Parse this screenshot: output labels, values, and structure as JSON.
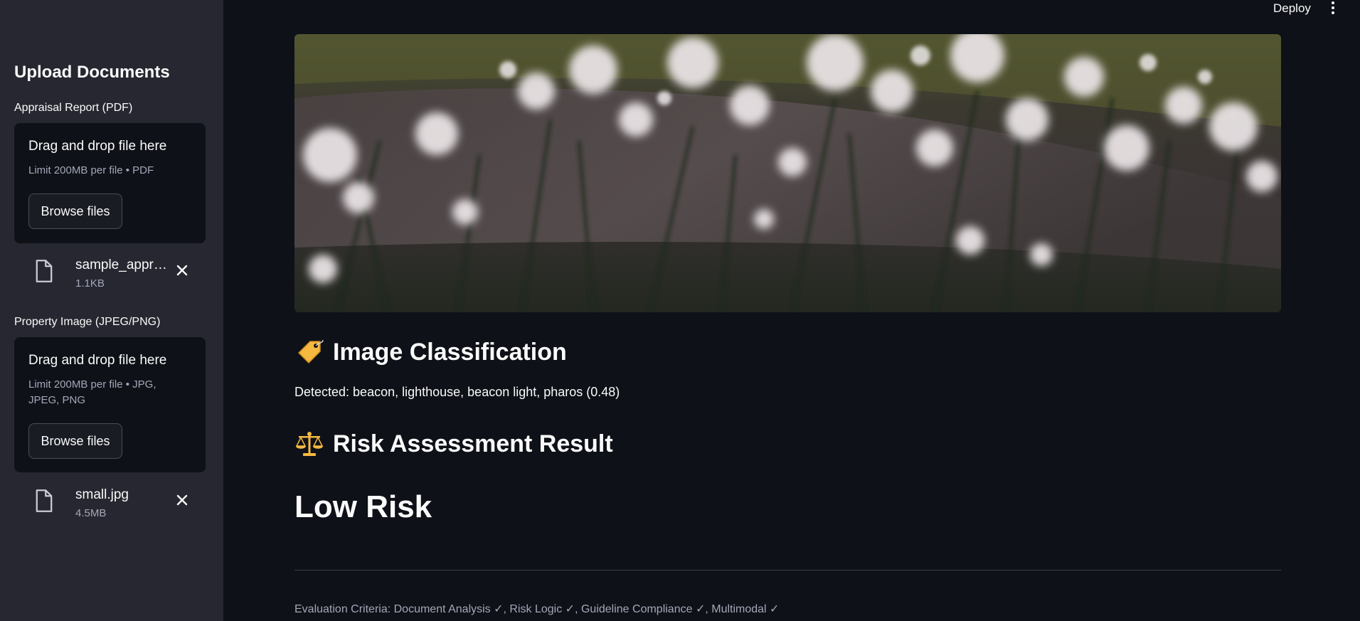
{
  "header": {
    "deploy_label": "Deploy",
    "menu_icon": "kebab-menu-icon"
  },
  "sidebar": {
    "title": "Upload Documents",
    "uploaders": [
      {
        "label": "Appraisal Report (PDF)",
        "dropzone_title": "Drag and drop file here",
        "limit": "Limit 200MB per file • PDF",
        "browse_label": "Browse files",
        "file": {
          "name": "sample_appr…",
          "size": "1.1KB"
        }
      },
      {
        "label": "Property Image (JPEG/PNG)",
        "dropzone_title": "Drag and drop file here",
        "limit": "Limit 200MB per file • JPG, JPEG, PNG",
        "browse_label": "Browse files",
        "file": {
          "name": "small.jpg",
          "size": "4.5MB"
        }
      }
    ]
  },
  "main": {
    "classification_heading": "Image Classification",
    "classification_icon": "tag-icon",
    "detected_text": "Detected: beacon, lighthouse, beacon light, pharos (0.48)",
    "risk_heading": "Risk Assessment Result",
    "risk_icon": "scales-icon",
    "risk_result": "Low Risk",
    "criteria_text": "Evaluation Criteria: Document Analysis ✓, Risk Logic ✓, Guideline Compliance ✓, Multimodal ✓"
  },
  "colors": {
    "background": "#0e1117",
    "sidebar": "#262730",
    "text": "#fafafa",
    "muted": "#a3a8b8",
    "accent": "#f5b942"
  }
}
